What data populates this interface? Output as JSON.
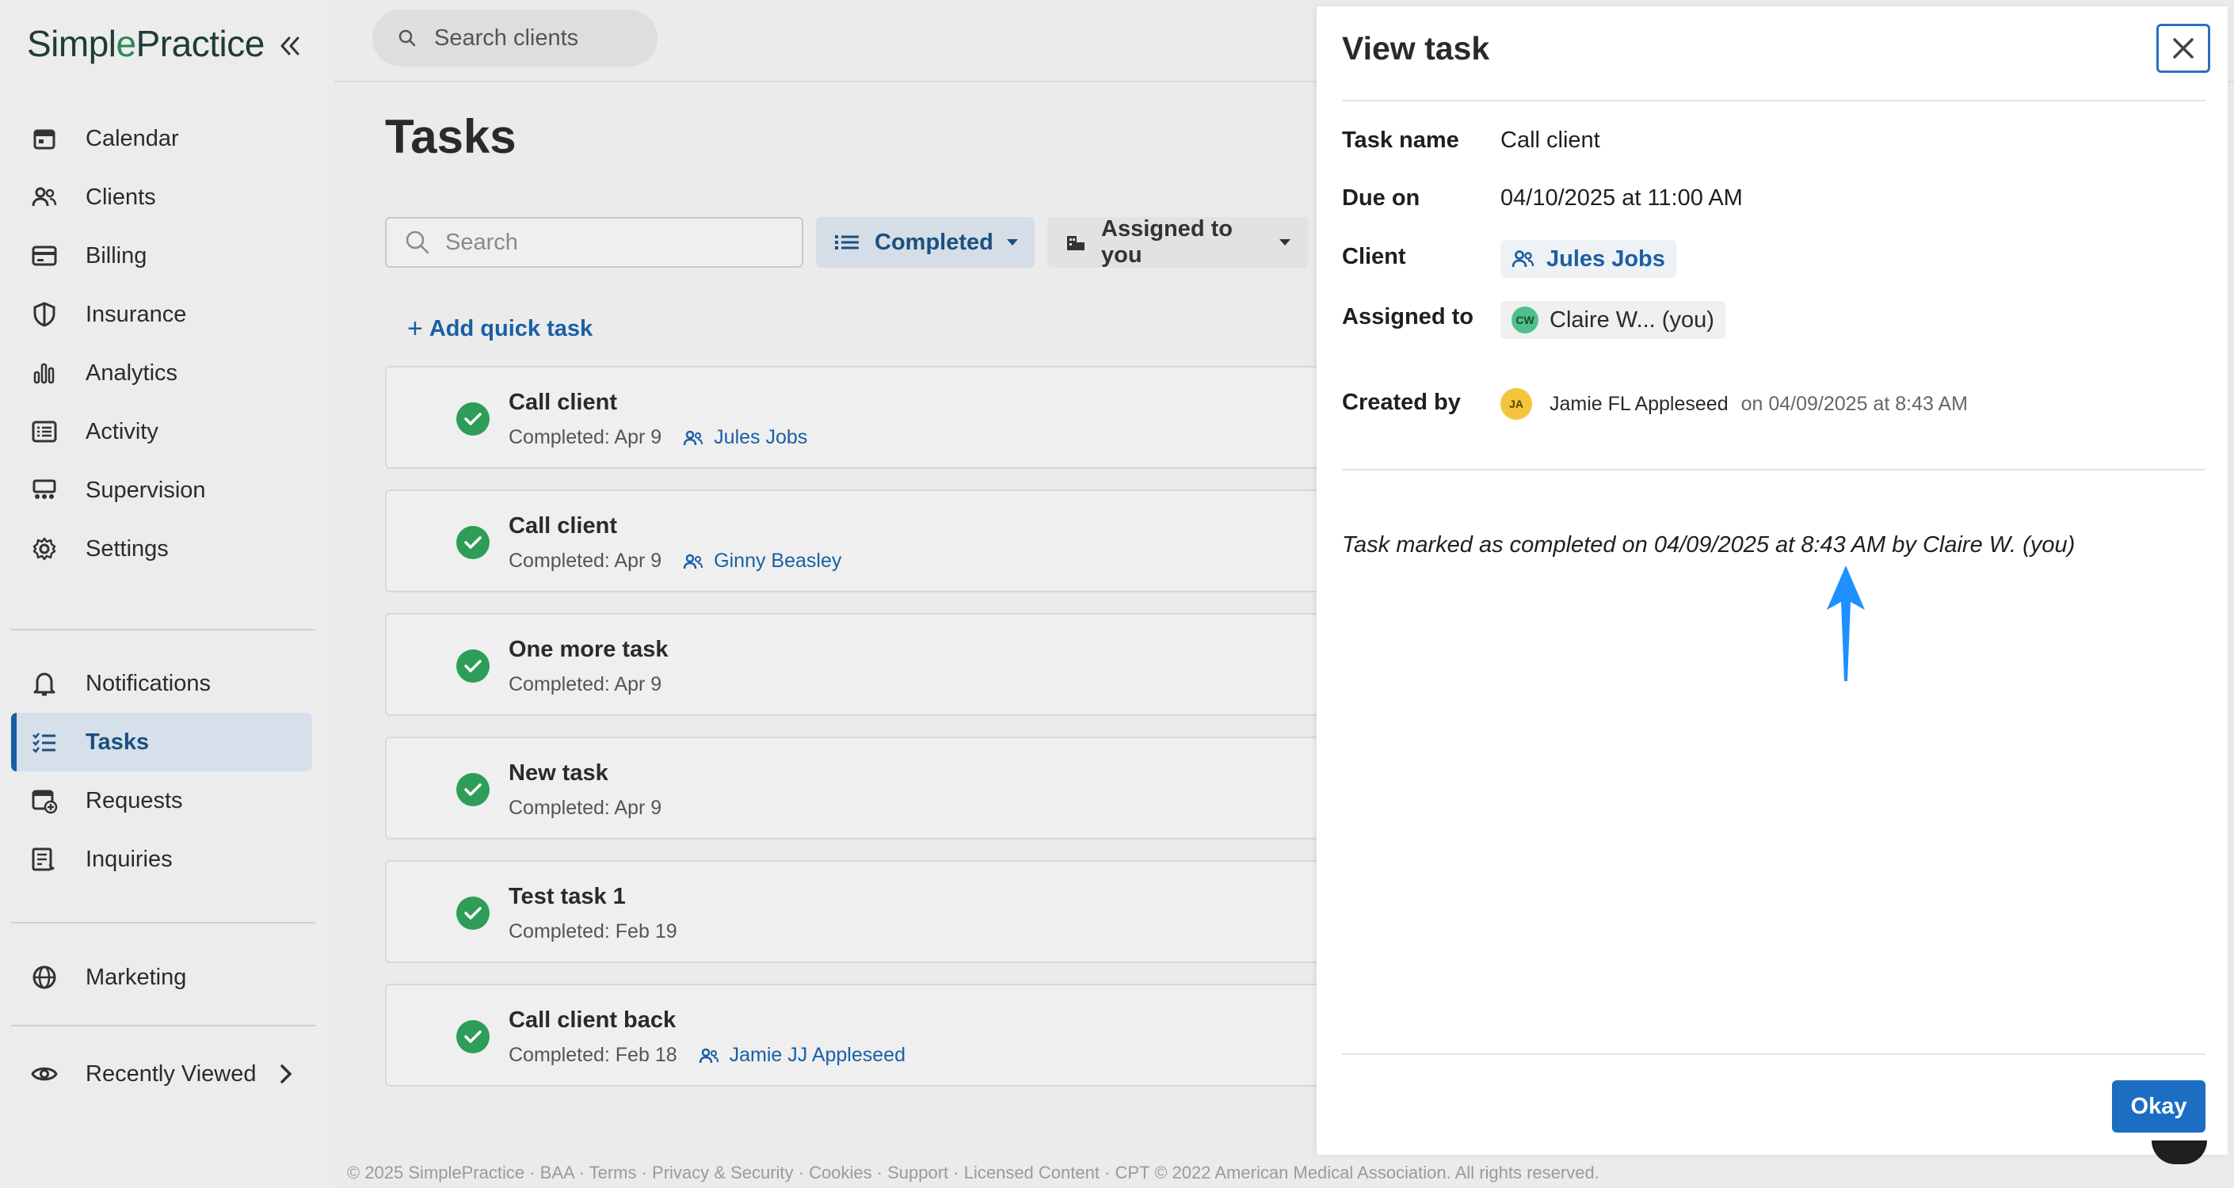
{
  "app": {
    "logo_text_a": "Simpl",
    "logo_text_leaf": "e",
    "logo_text_b": "Practice"
  },
  "sidebar": {
    "items": [
      {
        "label": "Calendar",
        "icon": "calendar-icon"
      },
      {
        "label": "Clients",
        "icon": "clients-icon"
      },
      {
        "label": "Billing",
        "icon": "billing-icon"
      },
      {
        "label": "Insurance",
        "icon": "shield-icon"
      },
      {
        "label": "Analytics",
        "icon": "bar-chart-icon"
      },
      {
        "label": "Activity",
        "icon": "activity-list-icon"
      },
      {
        "label": "Supervision",
        "icon": "supervision-icon"
      },
      {
        "label": "Settings",
        "icon": "gear-icon"
      }
    ],
    "items2": [
      {
        "label": "Notifications",
        "icon": "bell-icon"
      },
      {
        "label": "Tasks",
        "icon": "checklist-icon",
        "active": true
      },
      {
        "label": "Requests",
        "icon": "calendar-plus-icon"
      },
      {
        "label": "Inquiries",
        "icon": "inquiries-icon"
      }
    ],
    "marketing": "Marketing",
    "recently_viewed": "Recently Viewed"
  },
  "topbar": {
    "search_placeholder": "Search clients"
  },
  "page": {
    "title": "Tasks",
    "search_placeholder": "Search",
    "filter_status": "Completed",
    "filter_assignee": "Assigned to you",
    "add_quick_task": "Add quick task"
  },
  "tasks": [
    {
      "name": "Call client",
      "completed": "Completed: Apr 9",
      "client": "Jules Jobs"
    },
    {
      "name": "Call client",
      "completed": "Completed: Apr 9",
      "client": "Ginny Beasley"
    },
    {
      "name": "One more task",
      "completed": "Completed: Apr 9",
      "client": ""
    },
    {
      "name": "New task",
      "completed": "Completed: Apr 9",
      "client": ""
    },
    {
      "name": "Test task 1",
      "completed": "Completed: Feb 19",
      "client": ""
    },
    {
      "name": "Call client back",
      "completed": "Completed: Feb 18",
      "client": "Jamie JJ Appleseed"
    }
  ],
  "footer": "© 2025 SimplePractice · BAA · Terms · Privacy & Security · Cookies · Support · Licensed Content · CPT © 2022 American Medical Association. All rights reserved.",
  "modal": {
    "title": "View task",
    "task_name_label": "Task name",
    "task_name": "Call client",
    "due_label": "Due on",
    "due_value": "04/10/2025 at 11:00 AM",
    "client_label": "Client",
    "client_value": "Jules Jobs",
    "assigned_label": "Assigned to",
    "assigned_initials": "CW",
    "assigned_value": "Claire W... (you)",
    "created_label": "Created by",
    "created_initials": "JA",
    "created_name": "Jamie FL Appleseed",
    "created_on": "on 04/09/2025 at 8:43 AM",
    "history": "Task marked as completed on 04/09/2025 at 8:43 AM by Claire W. (you)",
    "okay_label": "Okay"
  },
  "colors": {
    "accent": "#1b5fa5",
    "success": "#2e9d57",
    "annotation_arrow": "#1e90ff"
  }
}
